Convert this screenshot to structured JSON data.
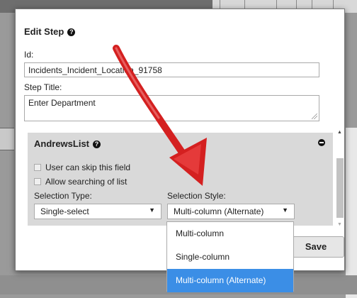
{
  "dialog": {
    "title": "Edit Step",
    "id_label": "Id:",
    "id_value": "Incidents_Incident_Location_91758",
    "step_title_label": "Step Title:",
    "step_title_value": "Enter Department",
    "save_label": "Save"
  },
  "list_panel": {
    "title": "AndrewsList",
    "skip_label": "User can skip this field",
    "search_label": "Allow searching of list",
    "selection_type_label": "Selection Type:",
    "selection_type_value": "Single-select",
    "selection_style_label": "Selection Style:",
    "selection_style_value": "Multi-column (Alternate)"
  },
  "style_options": [
    "Multi-column",
    "Single-column",
    "Multi-column (Alternate)"
  ],
  "icons": {
    "help": "question-circle-icon",
    "collapse": "minus-circle-icon",
    "dropdown": "caret-down-icon"
  },
  "colors": {
    "highlight": "#3b8ee6",
    "annotation_arrow": "#d42020"
  }
}
